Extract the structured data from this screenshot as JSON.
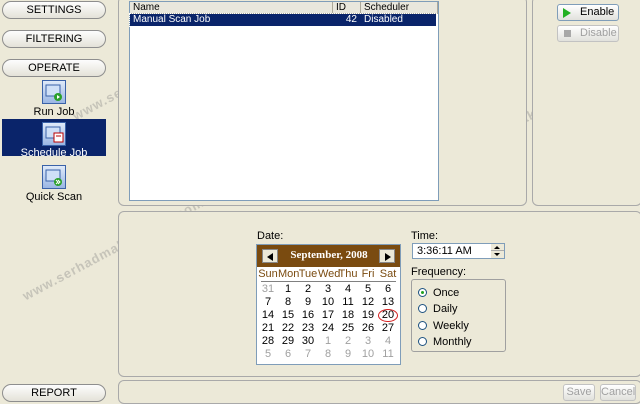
{
  "nav": {
    "settings": "SETTINGS",
    "filtering": "FILTERING",
    "operate": "OPERATE",
    "items": [
      {
        "label": "Run Job",
        "icon": "run-job-icon"
      },
      {
        "label": "Schedule Job",
        "icon": "schedule-job-icon",
        "selected": true
      },
      {
        "label": "Quick Scan",
        "icon": "quick-scan-icon"
      }
    ],
    "report": "REPORT"
  },
  "jobs": {
    "headers": [
      "Name",
      "ID",
      "Scheduler"
    ],
    "rows": [
      {
        "name": "Manual Scan Job",
        "id": "42",
        "scheduler": "Disabled"
      }
    ]
  },
  "actions": {
    "enable": "Enable",
    "disable": "Disable"
  },
  "schedule": {
    "date_label": "Date:",
    "month": "September, 2008",
    "weekdays": [
      "Sun",
      "Mon",
      "Tue",
      "Wed",
      "Thu",
      "Fri",
      "Sat"
    ],
    "days": [
      [
        "31",
        "1",
        "2",
        "3",
        "4",
        "5",
        "6"
      ],
      [
        "7",
        "8",
        "9",
        "10",
        "11",
        "12",
        "13"
      ],
      [
        "14",
        "15",
        "16",
        "17",
        "18",
        "19",
        "20"
      ],
      [
        "21",
        "22",
        "23",
        "24",
        "25",
        "26",
        "27"
      ],
      [
        "28",
        "29",
        "30",
        "1",
        "2",
        "3",
        "4"
      ],
      [
        "5",
        "6",
        "7",
        "8",
        "9",
        "10",
        "11"
      ]
    ],
    "today": "20",
    "time_label": "Time:",
    "time_value": "3:36:11 AM",
    "frequency_label": "Frequency:",
    "frequency_options": [
      "Once",
      "Daily",
      "Weekly",
      "Monthly"
    ],
    "frequency_selected": "Once"
  },
  "footer": {
    "save": "Save",
    "cancel": "Cancel"
  },
  "watermark": "www.serhadmakbuloglu.com.tr",
  "colors": {
    "selection": "#0a246a",
    "calendar_header": "#7a4b10",
    "today_ring": "#d42020",
    "enable_green": "#22b022"
  }
}
